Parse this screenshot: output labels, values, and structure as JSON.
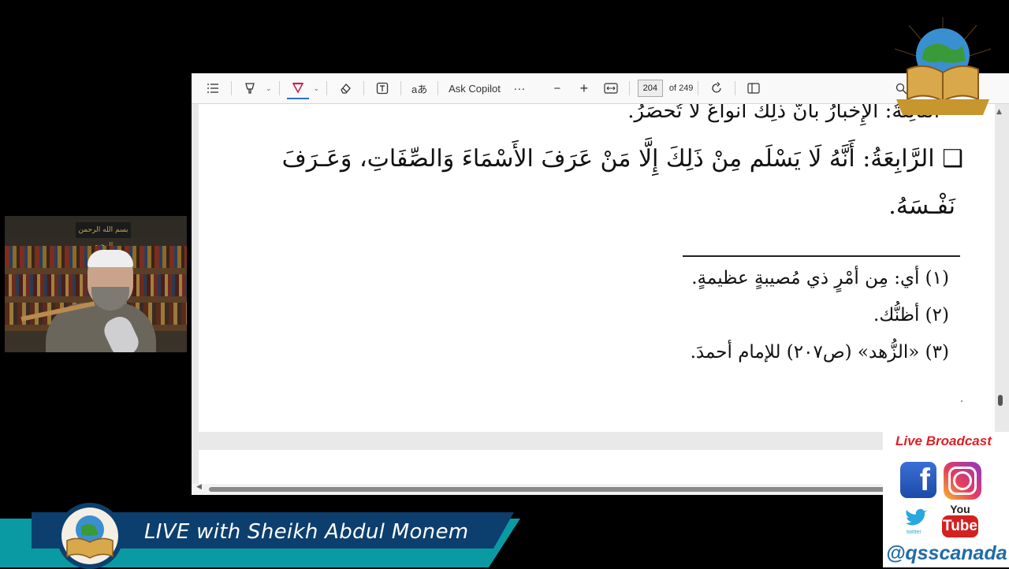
{
  "toolbar": {
    "ask_copilot": "Ask Copilot",
    "more": "···",
    "zoom_out": "−",
    "zoom_in": "+",
    "current_page": "204",
    "page_total": "of 249",
    "erase_icon_glyph": "⌫",
    "aa_label": "aあ"
  },
  "document": {
    "line1": "الثالِثةُ: الإِخبارُ بأنَّ ذلِكَ أنواعٌ لا تُحصَرُ.",
    "line2": "❑ الرَّابِعَةُ: أَنَّهُ لَا يَسْلَم مِنْ ذَلِكَ إِلَّا مَنْ عَرَفَ الأَسْمَاءَ وَالصِّفَاتِ، وَعَـرَفَ",
    "line3": "نَفْـسَهُ.",
    "footnotes": [
      "(١) أي: مِن أمْرٍ ذي مُصيبةٍ عظيمةٍ.",
      "(٢) أظنُّك.",
      "(٣) «الزُّهد» (ص٢٠٧) للإمام أحمدَ."
    ]
  },
  "webcam": {
    "plaque_text": "بسم الله الرحمن الرحيم"
  },
  "overlay": {
    "lower_third_title": "LIVE with Sheikh Abdul Monem",
    "live_broadcast": "Live Broadcast",
    "facebook_glyph": "f",
    "youtube_top": "You",
    "youtube_bottom": "Tube",
    "twitter_label": "twitter",
    "handle": "@qsscanada"
  },
  "colors": {
    "background": "#000000",
    "toolbar": "#f9f9f9",
    "accent": "#2f6fd6",
    "banner_teal": "#0a9aa4",
    "banner_navy": "#0c3f6e",
    "live_red": "#e01f26",
    "handle_blue": "#1f6ca8"
  }
}
